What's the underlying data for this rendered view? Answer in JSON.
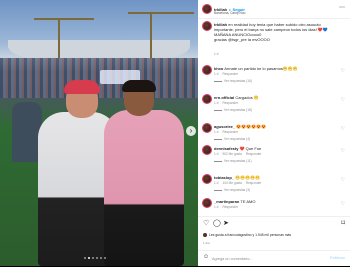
{
  "header": {
    "username": "trkillah",
    "separator": "•",
    "follow_label": "Seguir",
    "location": "Barcelona, Camp Nou",
    "more_icon": "more-horizontal-icon"
  },
  "caption": {
    "username": "trkillah",
    "text": "en realidad hoy tenia que haber subido otro asuuuto importante, pero el barça no sale campeon todos los dias! ❤️💙 MAÑANA ANUNCIOoooo0",
    "extra": "gracias @tsgr_pre la mvOOOO",
    "time": "1 d"
  },
  "comments": [
    {
      "username": "khxo",
      "text": "Armate un partido ke lo pasamos😁😁😁",
      "time": "1 d",
      "likes": "",
      "reply_label": "Responder",
      "replies": "Ver respuestas (16)"
    },
    {
      "username": "ern.official",
      "text": "Cargados 😁",
      "time": "1 d",
      "likes": "",
      "reply_label": "Responder",
      "replies": "Ver respuestas (18)"
    },
    {
      "username": "agusoriee_",
      "text": "😍😍😍😍😍😍",
      "time": "1 d",
      "likes": "",
      "reply_label": "Responder",
      "replies": "Ver respuestas (4)"
    },
    {
      "username": "dennisafesty",
      "text": "❤️ Que Fue",
      "time": "1 d",
      "likes": "902 Me gusta",
      "reply_label": "Responder",
      "replies": "Ver respuestas (11)"
    },
    {
      "username": "tobiaslop_",
      "text": "😁😁😁😁😁",
      "time": "1 d",
      "likes": "104 Me gusta",
      "reply_label": "Responder",
      "replies": "Ver respuestas (3)"
    },
    {
      "username": "_martinparan",
      "text": "TE AMO",
      "time": "1 d",
      "likes": "",
      "reply_label": "Responder",
      "replies": ""
    }
  ],
  "actions": {
    "like_icon": "heart-icon",
    "comment_icon": "comment-icon",
    "share_icon": "share-icon",
    "save_icon": "bookmark-icon"
  },
  "likes_text": "Les gusta a francodagostino y 1.545 mil personas más",
  "date": "1 día",
  "add_comment": {
    "placeholder": "Agrega un comentario...",
    "post_label": "Publicar",
    "emoji_icon": "emoji-icon"
  },
  "carousel": {
    "next_icon": "chevron-right-icon",
    "dots": 6,
    "active_dot": 1
  },
  "colors": {
    "follow_blue": "#0095f6",
    "story_ring": "#e1306c",
    "pink_hoodie": "#df95ae",
    "hair_red": "#d63c4e"
  }
}
